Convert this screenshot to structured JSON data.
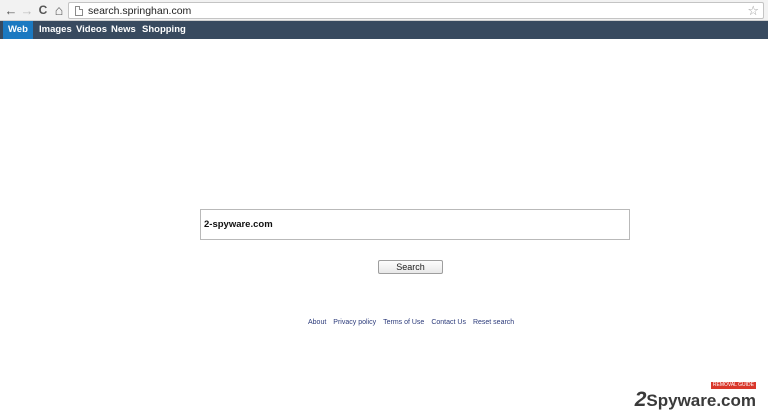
{
  "browser": {
    "url": "search.springhan.com",
    "back_icon": "←",
    "forward_icon": "→",
    "reload_icon": "C",
    "home_icon": "⌂",
    "star_icon": "☆"
  },
  "navbar": {
    "tabs": [
      "Web",
      "Images",
      "Videos",
      "News",
      "Shopping"
    ],
    "active": "Web",
    "colors": {
      "background": "#384a5f",
      "active": "#1b79c1"
    }
  },
  "search": {
    "value": "2-spyware.com",
    "button_label": "Search"
  },
  "footer": {
    "links": [
      "About",
      "Privacy policy",
      "Terms of Use",
      "Contact Us",
      "Reset search"
    ]
  },
  "watermark": {
    "prefix": "2",
    "text": "Spyware.com",
    "badge": "REMOVAL GUIDE"
  }
}
